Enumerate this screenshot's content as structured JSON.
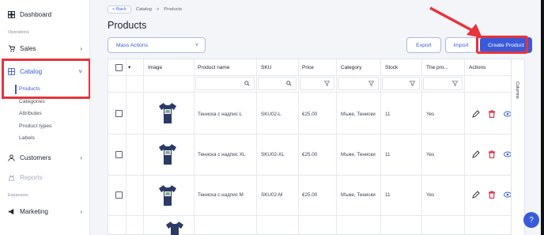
{
  "sidebar": {
    "dashboard": "Dashboard",
    "section_operations": "Operations",
    "sales": "Sales",
    "catalog": "Catalog",
    "catalog_items": [
      "Products",
      "Categories",
      "Attributes",
      "Product types",
      "Labels"
    ],
    "customers": "Customers",
    "reports": "Reports",
    "section_expansion": "Expansion",
    "marketing": "Marketing"
  },
  "breadcrumb": {
    "back": "< Back",
    "items": [
      "Catalog",
      ">",
      "Products"
    ]
  },
  "page": {
    "title": "Products"
  },
  "toolbar": {
    "mass_actions": "Mass Actions",
    "export": "Export",
    "import": "Import",
    "create": "Create Product"
  },
  "table": {
    "headers": [
      "Image",
      "Product name",
      "SKU",
      "Price",
      "Category",
      "Stock",
      "The pro...",
      "Actions"
    ],
    "columns_tab": "Columns",
    "rows": [
      {
        "name": "Тениска с надпис L",
        "sku": "SKU02-L",
        "price": "€25.00",
        "category": "Мъже, Тениски",
        "stock": "11",
        "pro": "Yes"
      },
      {
        "name": "Тениска с надпис XL",
        "sku": "SKU02-XL",
        "price": "€25.00",
        "category": "Мъже, Тениски",
        "stock": "11",
        "pro": "Yes"
      },
      {
        "name": "Тениска с надпис M",
        "sku": "SKU02-M",
        "price": "€25.00",
        "category": "Мъже, Тениски",
        "stock": "11",
        "pro": "Yes"
      }
    ]
  },
  "colors": {
    "accent": "#3a5bd9",
    "annotation": "#e8333b",
    "delete": "#e0344a",
    "shirt": "#2b3a66"
  },
  "icons": [
    "dashboard-icon",
    "sales-icon",
    "catalog-icon",
    "customers-icon",
    "reports-icon",
    "marketing-icon",
    "edit-icon",
    "delete-icon",
    "view-icon",
    "search-icon",
    "filter-icon",
    "help-icon"
  ]
}
